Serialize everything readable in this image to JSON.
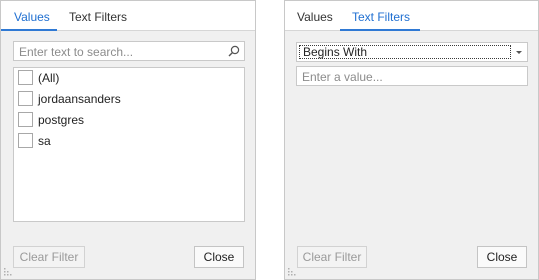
{
  "left_panel": {
    "tabs": [
      {
        "label": "Values",
        "active": true
      },
      {
        "label": "Text Filters",
        "active": false
      }
    ],
    "search": {
      "placeholder": "Enter text to search..."
    },
    "items": [
      {
        "label": "(All)",
        "checked": false
      },
      {
        "label": "jordaansanders",
        "checked": false
      },
      {
        "label": "postgres",
        "checked": false
      },
      {
        "label": "sa",
        "checked": false
      }
    ],
    "clear_label": "Clear Filter",
    "close_label": "Close"
  },
  "right_panel": {
    "tabs": [
      {
        "label": "Values",
        "active": false
      },
      {
        "label": "Text Filters",
        "active": true
      }
    ],
    "operator": "Begins With",
    "value_placeholder": "Enter a value...",
    "clear_label": "Clear Filter",
    "close_label": "Close"
  },
  "colors": {
    "accent": "#2f79d4",
    "active_tab_text": "#1f6fd1",
    "panel_bg": "#f0f0f0"
  },
  "icons": [
    "search-icon",
    "chevron-down-icon",
    "resize-grip-icon"
  ]
}
